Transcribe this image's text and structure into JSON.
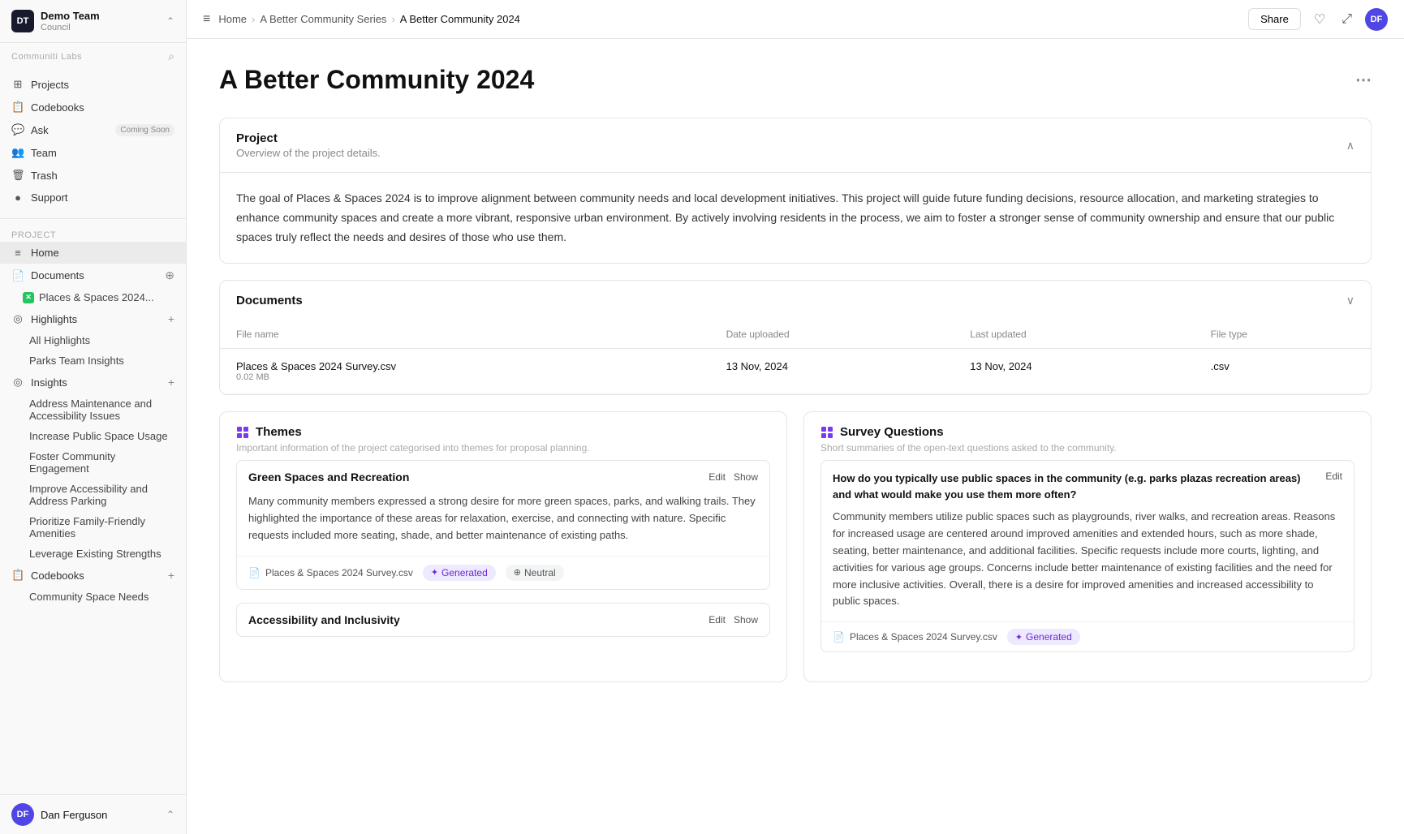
{
  "brand": {
    "name": "Demo Team",
    "sub": "Council",
    "initials": "DT"
  },
  "workspace": "Communiti Labs",
  "nav": {
    "items": [
      {
        "id": "projects",
        "label": "Projects",
        "icon": "⊞"
      },
      {
        "id": "codebooks",
        "label": "Codebooks",
        "icon": "📋"
      },
      {
        "id": "ask",
        "label": "Ask",
        "icon": "💬",
        "badge": "Coming Soon"
      },
      {
        "id": "team",
        "label": "Team",
        "icon": "👥"
      },
      {
        "id": "trash",
        "label": "Trash",
        "icon": "🗑"
      },
      {
        "id": "support",
        "label": "Support",
        "icon": "🔵"
      }
    ]
  },
  "project": {
    "section_label": "Project",
    "home": "Home",
    "documents": "Documents",
    "documents_file": "Places & Spaces 2024...",
    "highlights": {
      "label": "Highlights",
      "children": [
        "All Highlights",
        "Parks Team Insights"
      ]
    },
    "insights": {
      "label": "Insights",
      "children": [
        "Address Maintenance and Accessibility Issues",
        "Increase Public Space Usage",
        "Foster Community Engagement",
        "Improve Accessibility and Address Parking",
        "Prioritize Family-Friendly Amenities",
        "Leverage Existing Strengths"
      ]
    },
    "codebooks": {
      "label": "Codebooks",
      "children": [
        "Community Space Needs"
      ]
    }
  },
  "user": {
    "name": "Dan Ferguson",
    "initials": "DF"
  },
  "topbar": {
    "hamburger": "≡",
    "breadcrumbs": [
      "Home",
      "A Better Community Series",
      "A Better Community 2024"
    ],
    "share_label": "Share"
  },
  "page": {
    "title": "A Better Community 2024",
    "more_icon": "⋯"
  },
  "project_card": {
    "title": "Project",
    "subtitle": "Overview of the project details.",
    "body": "The goal of Places & Spaces 2024 is to improve alignment between community needs and local development initiatives. This project will guide future funding decisions, resource allocation, and marketing strategies to enhance community spaces and create a more vibrant, responsive urban environment. By actively involving residents in the process, we aim to foster a stronger sense of community ownership and ensure that our public spaces truly reflect the needs and desires of those who use them."
  },
  "documents_card": {
    "title": "Documents",
    "columns": [
      "File name",
      "Date uploaded",
      "Last updated",
      "File type"
    ],
    "rows": [
      {
        "name": "Places & Spaces 2024 Survey.csv",
        "size": "0.02 MB",
        "date_uploaded": "13 Nov, 2024",
        "last_updated": "13 Nov, 2024",
        "file_type": ".csv"
      }
    ]
  },
  "themes_card": {
    "title": "Themes",
    "subtitle": "Important information of the project categorised into themes for proposal planning.",
    "items": [
      {
        "title": "Green Spaces and Recreation",
        "body": "Many community members expressed a strong desire for more green spaces, parks, and walking trails. They highlighted the importance of these areas for relaxation, exercise, and connecting with nature. Specific requests included more seating, shade, and better maintenance of existing paths.",
        "file_ref": "Places & Spaces 2024 Survey.csv",
        "badges": [
          {
            "type": "generated",
            "label": "Generated",
            "icon": "✦"
          },
          {
            "type": "neutral",
            "label": "Neutral",
            "icon": "⊕"
          }
        ]
      },
      {
        "title": "Accessibility and Inclusivity",
        "body": "",
        "file_ref": "",
        "badges": []
      }
    ]
  },
  "survey_card": {
    "title": "Survey Questions",
    "subtitle": "Short summaries of the open-text questions asked to the community.",
    "items": [
      {
        "question": "How do you typically use public spaces in the community (e.g. parks plazas recreation areas) and what would make you use them more often?",
        "body": "Community members utilize public spaces such as playgrounds, river walks, and recreation areas. Reasons for increased usage are centered around improved amenities and extended hours, such as more shade, seating, better maintenance, and additional facilities. Specific requests include more courts, lighting, and activities for various age groups. Concerns include better maintenance of existing facilities and the need for more inclusive activities. Overall, there is a desire for improved amenities and increased accessibility to public spaces.",
        "file_ref": "Places & Spaces 2024 Survey.csv",
        "badge": {
          "type": "generated",
          "label": "Generated",
          "icon": "✦"
        }
      }
    ]
  }
}
